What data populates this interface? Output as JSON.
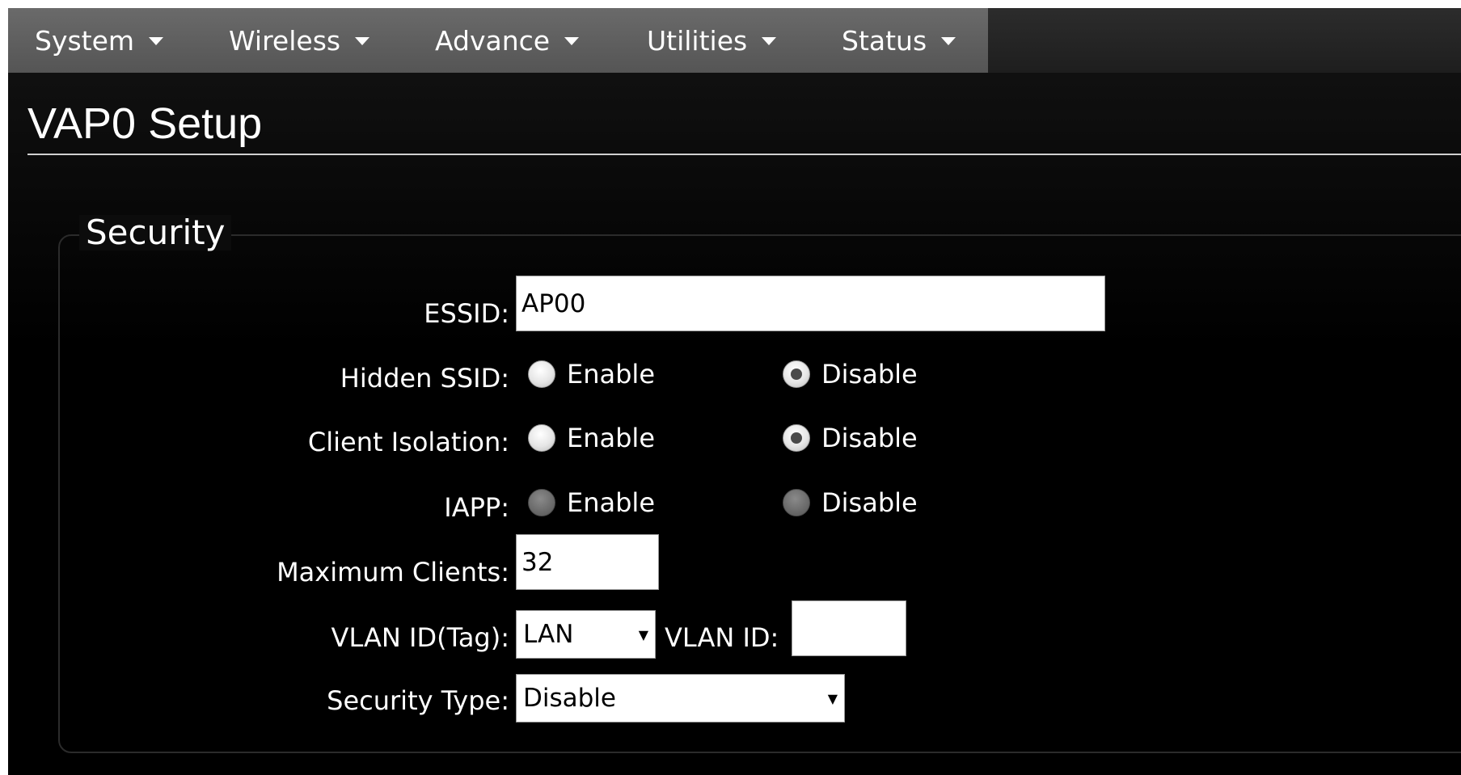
{
  "menu": {
    "items": [
      {
        "label": "System"
      },
      {
        "label": "Wireless"
      },
      {
        "label": "Advance"
      },
      {
        "label": "Utilities"
      },
      {
        "label": "Status"
      }
    ]
  },
  "page": {
    "title": "VAP0 Setup"
  },
  "security": {
    "legend": "Security",
    "essid": {
      "label": "ESSID:",
      "value": "AP00"
    },
    "hidden_ssid": {
      "label": "Hidden SSID:",
      "enable": "Enable",
      "disable": "Disable",
      "selected": "Disable"
    },
    "client_isolation": {
      "label": "Client Isolation:",
      "enable": "Enable",
      "disable": "Disable",
      "selected": "Disable"
    },
    "iapp": {
      "label": "IAPP:",
      "enable": "Enable",
      "disable": "Disable",
      "selected": null,
      "disabled": true
    },
    "max_clients": {
      "label": "Maximum Clients:",
      "value": "32"
    },
    "vlan": {
      "tag_label": "VLAN ID(Tag):",
      "tag_value": "LAN",
      "id_label": "VLAN ID:",
      "id_value": ""
    },
    "security_type": {
      "label": "Security Type:",
      "value": "Disable"
    }
  }
}
